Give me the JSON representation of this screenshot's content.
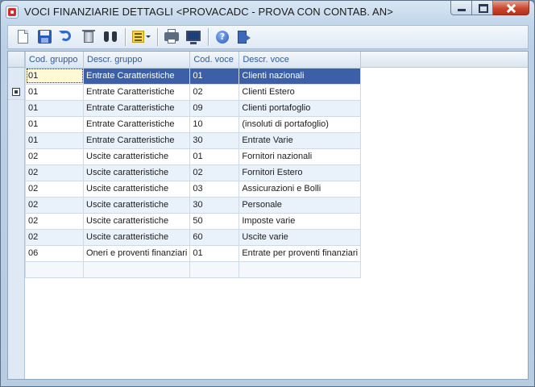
{
  "window": {
    "title": "VOCI FINANZIARIE DETTAGLI <PROVACADC - PROVA CON CONTAB. AN>"
  },
  "toolbar": {
    "buttons": [
      {
        "name": "new",
        "icon": "new-document-icon"
      },
      {
        "name": "save",
        "icon": "save-disk-icon"
      },
      {
        "name": "undo",
        "icon": "undo-arrow-icon"
      },
      {
        "name": "delete",
        "icon": "trash-icon"
      },
      {
        "name": "find",
        "icon": "binoculars-icon"
      },
      {
        "name": "list",
        "icon": "list-view-icon"
      },
      {
        "name": "print",
        "icon": "printer-icon"
      },
      {
        "name": "preview",
        "icon": "monitor-icon"
      },
      {
        "name": "help",
        "icon": "help-icon",
        "glyph": "?"
      },
      {
        "name": "exit",
        "icon": "exit-door-icon"
      }
    ]
  },
  "grid": {
    "columns": [
      "Cod. gruppo",
      "Descr. gruppo",
      "Cod. voce",
      "Descr. voce"
    ],
    "rows": [
      [
        "01",
        "Entrate Caratteristiche",
        "01",
        "Clienti nazionali"
      ],
      [
        "01",
        "Entrate Caratteristiche",
        "02",
        "Clienti Estero"
      ],
      [
        "01",
        "Entrate Caratteristiche",
        "09",
        "Clienti portafoglio"
      ],
      [
        "01",
        "Entrate Caratteristiche",
        "10",
        "(insoluti di portafoglio)"
      ],
      [
        "01",
        "Entrate Caratteristiche",
        "30",
        "Entrate Varie"
      ],
      [
        "02",
        "Uscite caratteristiche",
        "01",
        "Fornitori nazionali"
      ],
      [
        "02",
        "Uscite caratteristiche",
        "02",
        "Fornitori Estero"
      ],
      [
        "02",
        "Uscite caratteristiche",
        "03",
        "Assicurazioni e Bolli"
      ],
      [
        "02",
        "Uscite caratteristiche",
        "30",
        "Personale"
      ],
      [
        "02",
        "Uscite caratteristiche",
        "50",
        "Imposte varie"
      ],
      [
        "02",
        "Uscite caratteristiche",
        "60",
        "Uscite varie"
      ],
      [
        "06",
        "Oneri e proventi finanziari",
        "01",
        "Entrate per proventi finanziari"
      ]
    ]
  },
  "colors": {
    "selected_row": "#3d5fa8",
    "header_text": "#2e5b9a",
    "close_button": "#c9482e"
  }
}
